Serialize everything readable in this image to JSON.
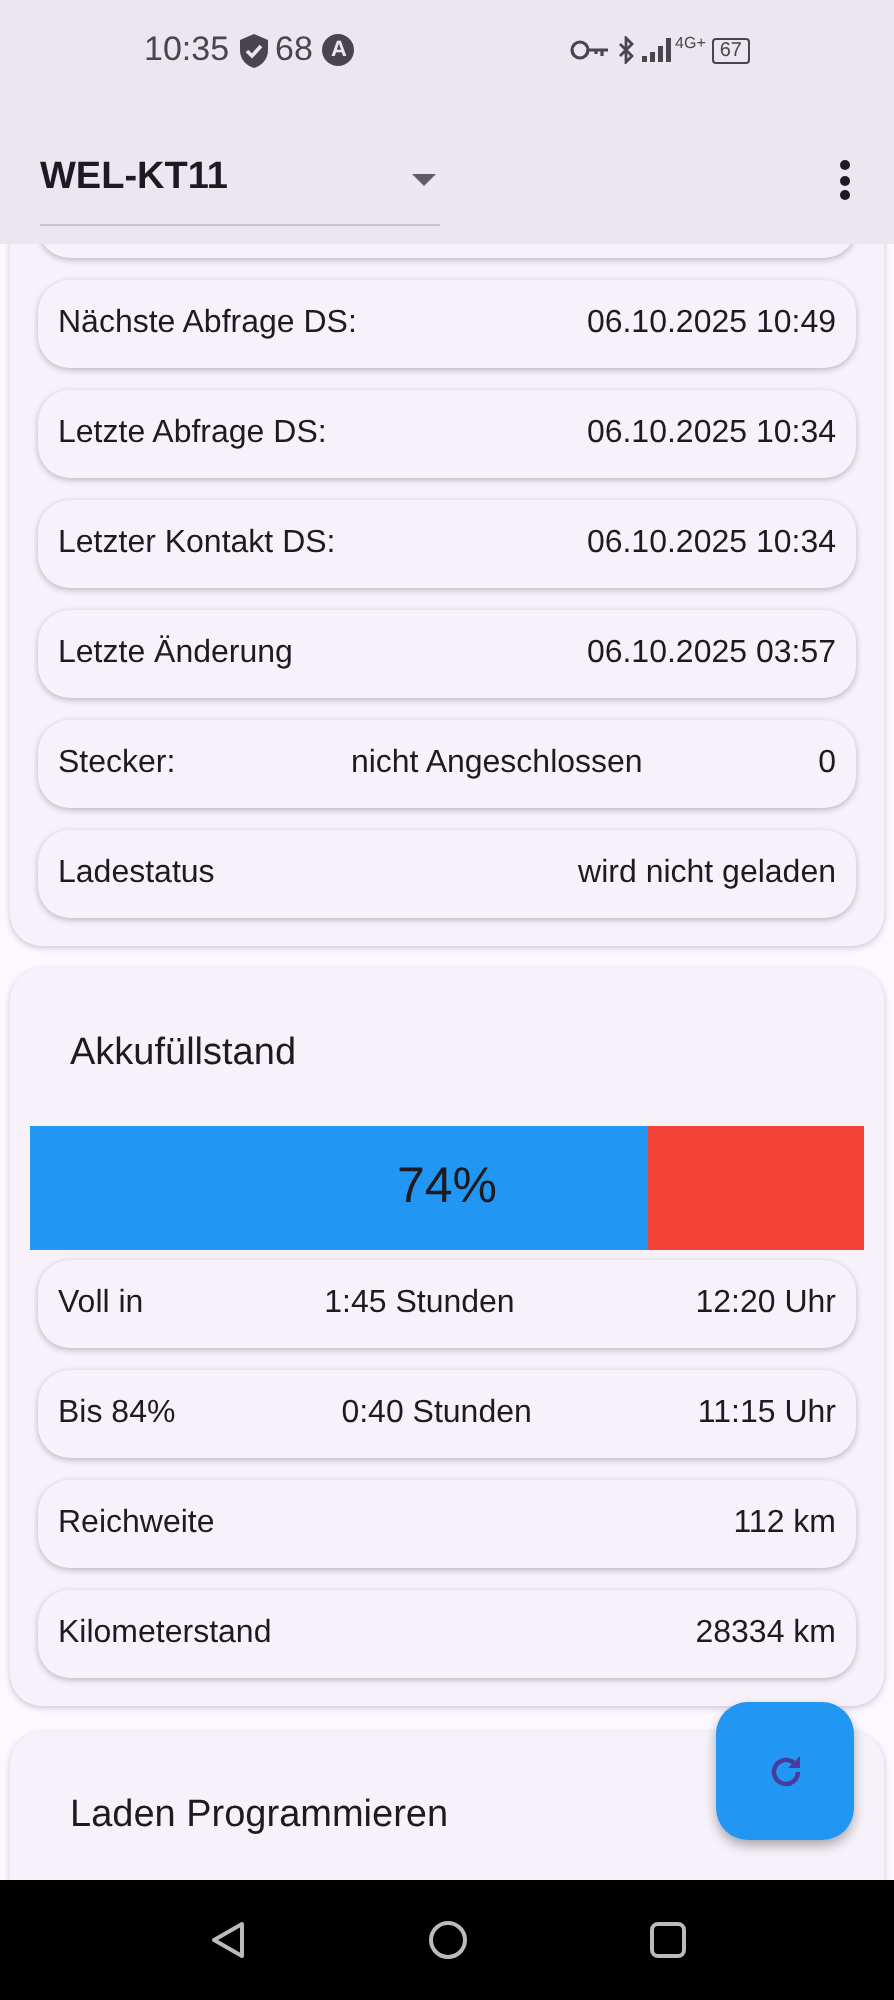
{
  "status_bar": {
    "time": "10:35",
    "notification_count": "68",
    "badge_letter": "A",
    "network": "4G+",
    "battery": "67"
  },
  "app_bar": {
    "title": "WEL-KT11"
  },
  "status_card": {
    "rows": [
      {
        "label": "Nächste Abfrage DS:",
        "values": [
          "06.10.2025 10:49"
        ]
      },
      {
        "label": "Letzte Abfrage DS:",
        "values": [
          "06.10.2025 10:34"
        ]
      },
      {
        "label": "Letzter Kontakt DS:",
        "values": [
          "06.10.2025 10:34"
        ]
      },
      {
        "label": "Letzte Änderung",
        "values": [
          "06.10.2025 03:57"
        ]
      },
      {
        "label": "Stecker:",
        "values": [
          "nicht Angeschlossen",
          "0"
        ]
      },
      {
        "label": "Ladestatus",
        "values": [
          "wird nicht geladen"
        ]
      }
    ]
  },
  "battery_card": {
    "title": "Akkufüllstand",
    "bar": {
      "level": 0.74,
      "label": "74%"
    },
    "rows": [
      {
        "label": "Voll in",
        "values": [
          "1:45 Stunden",
          "12:20 Uhr"
        ]
      },
      {
        "label": "Bis 84%",
        "values": [
          "0:40 Stunden",
          "11:15 Uhr"
        ]
      },
      {
        "label": "Reichweite",
        "values": [
          "112 km"
        ]
      },
      {
        "label": "Kilometerstand",
        "values": [
          "28334 km"
        ]
      }
    ]
  },
  "program_card": {
    "title": "Laden Programmieren"
  }
}
